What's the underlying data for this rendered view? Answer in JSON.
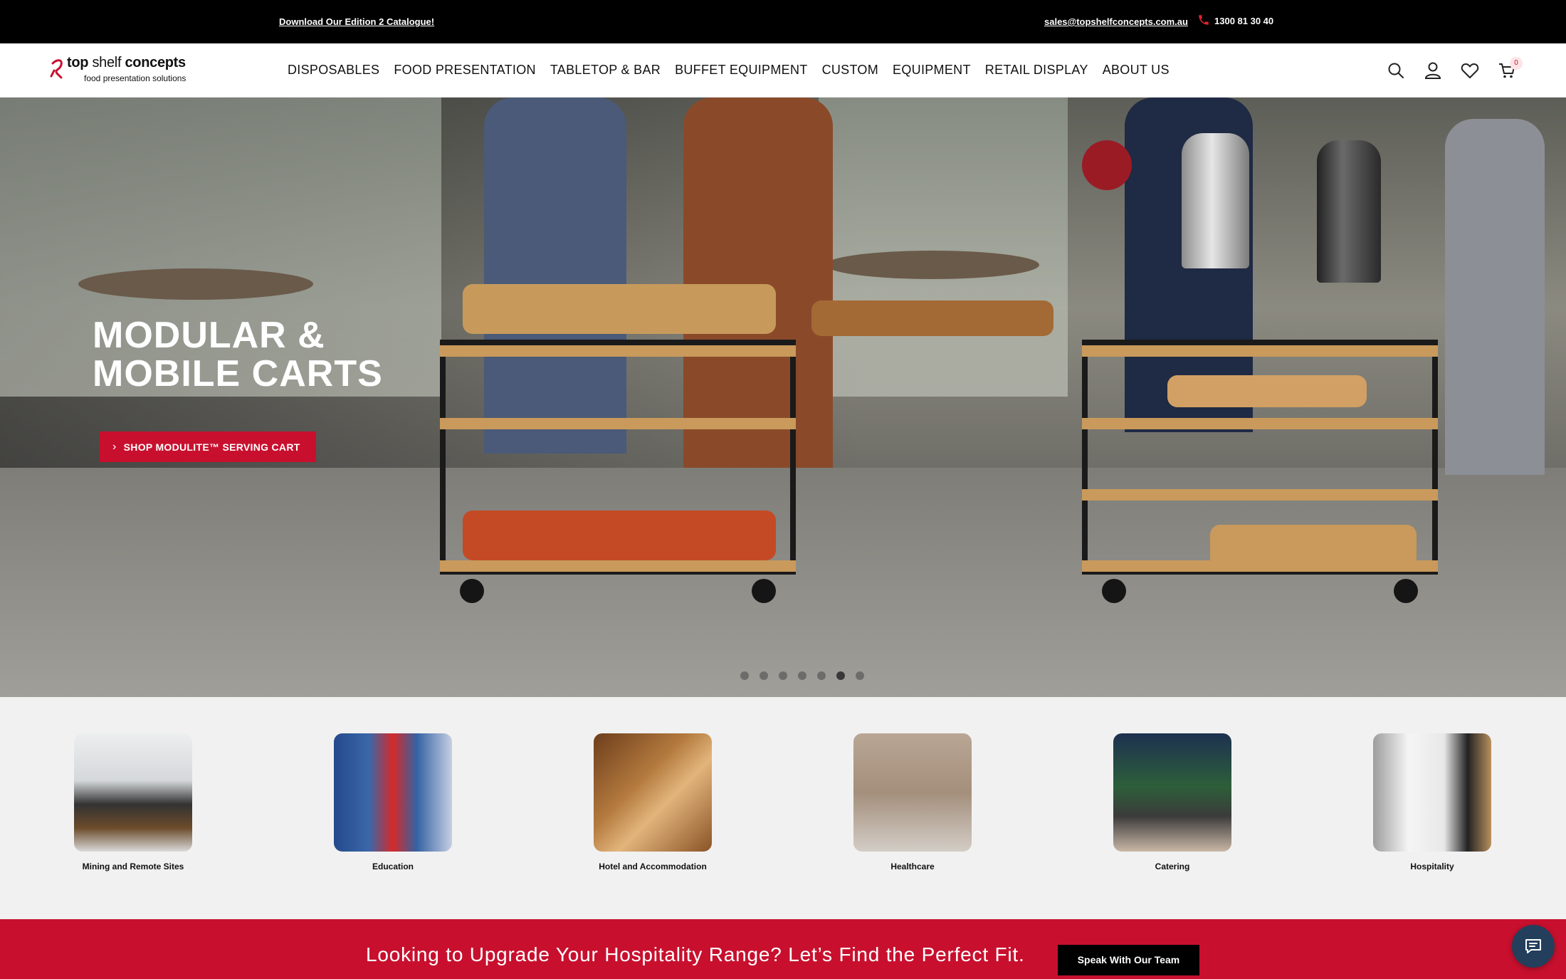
{
  "topbar": {
    "catalogue_link": "Download Our Edition 2 Catalogue!",
    "email": "sales@topshelfconcepts.com.au",
    "phone": "1300 81 30 40"
  },
  "logo": {
    "brand_part1": "top ",
    "brand_part2": "shelf",
    "brand_part3": " concepts",
    "tagline": "food presentation solutions"
  },
  "nav": {
    "items": [
      "DISPOSABLES",
      "FOOD PRESENTATION",
      "TABLETOP & BAR",
      "BUFFET EQUIPMENT",
      "CUSTOM",
      "EQUIPMENT",
      "RETAIL DISPLAY",
      "ABOUT US"
    ]
  },
  "header_icons": {
    "search": "search-icon",
    "account": "user-icon",
    "wishlist": "heart-icon",
    "cart": "cart-icon",
    "cart_count": "0"
  },
  "hero": {
    "title_line1": "MODULAR &",
    "title_line2": "MOBILE CARTS",
    "button_label": "SHOP MODULITE™ SERVING CART",
    "slide_count": 7,
    "active_slide": 6
  },
  "categories": [
    {
      "label": "Mining and Remote Sites"
    },
    {
      "label": "Education"
    },
    {
      "label": "Hotel and Accommodation"
    },
    {
      "label": "Healthcare"
    },
    {
      "label": "Catering"
    },
    {
      "label": "Hospitality"
    }
  ],
  "banner": {
    "message": "Looking to Upgrade Your Hospitality Range? Let’s Find the Perfect Fit.",
    "cta": "Speak With Our Team"
  },
  "colors": {
    "brand_red": "#c8102e",
    "topbar": "#000000",
    "chat_button": "#233f5c"
  }
}
